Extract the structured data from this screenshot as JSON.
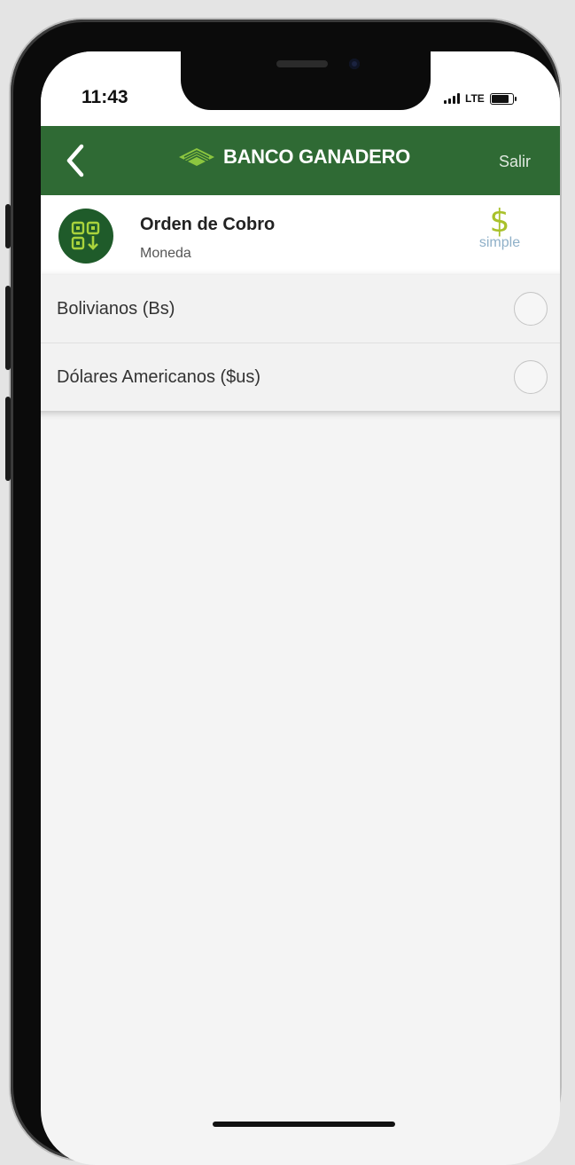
{
  "status_bar": {
    "time": "11:43",
    "network": "LTE",
    "battery_level": 0.85
  },
  "navbar": {
    "back_icon": "chevron-left-icon",
    "brand_logo_icon": "banco-ganadero-leaf-icon",
    "brand_name": "BANCO GANADERO",
    "logout_label": "Salir",
    "bg_color": "#2f6a34"
  },
  "header": {
    "icon": "qr-code-download-icon",
    "title": "Orden de Cobro",
    "subtitle": "Moneda",
    "simple_logo": {
      "symbol": "$",
      "word": "simple"
    }
  },
  "currency_options": [
    {
      "label": "Bolivianos (Bs)",
      "selected": false
    },
    {
      "label": "Dólares Americanos ($us)",
      "selected": false
    }
  ]
}
